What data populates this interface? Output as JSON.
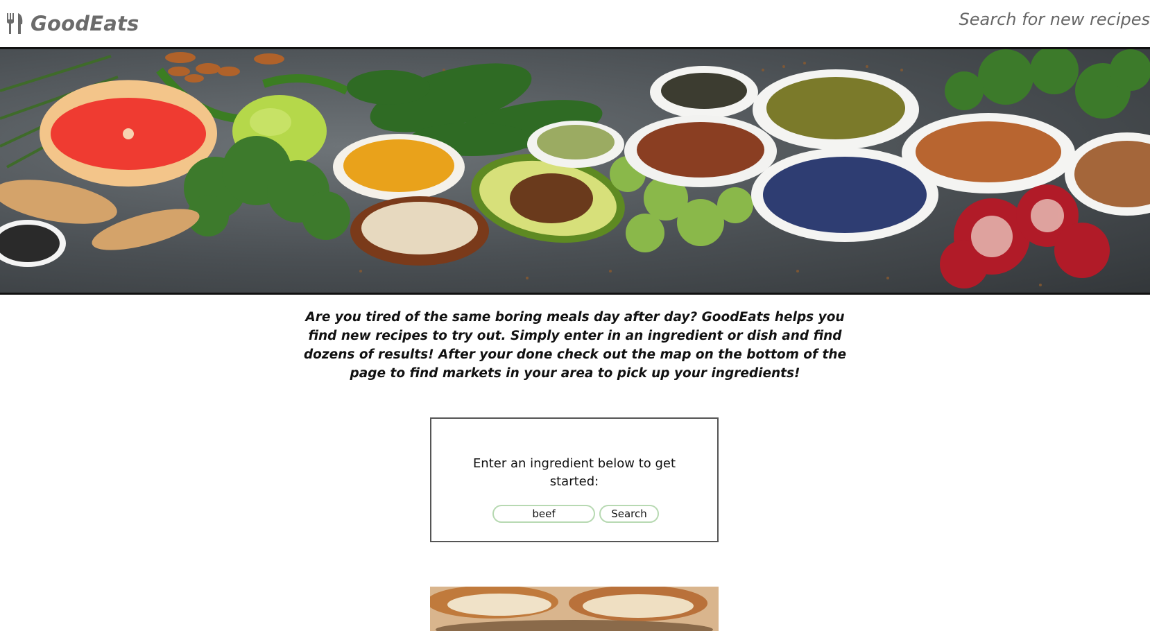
{
  "header": {
    "brand_name": "GoodEats",
    "brand_icon": "fork-knife-icon",
    "search_link": "Search for new recipes"
  },
  "hero": {
    "image": "vegetables-spices-banner"
  },
  "intro": {
    "text": "Are you tired of the same boring meals day after day? GoodEats helps you find new recipes to try out. Simply enter in an ingredient or dish and find dozens of results! After your done check out the map on the bottom of the page to find markets in your area to pick up your ingredients!"
  },
  "search_card": {
    "prompt": "Enter an ingredient below to get started:",
    "input_value": "beef",
    "button_label": "Search"
  },
  "result": {
    "image": "bread-loaf-photo"
  },
  "colors": {
    "brand": "#6b6b6b",
    "input_border": "#b7d9b2",
    "rule": "#111111"
  }
}
